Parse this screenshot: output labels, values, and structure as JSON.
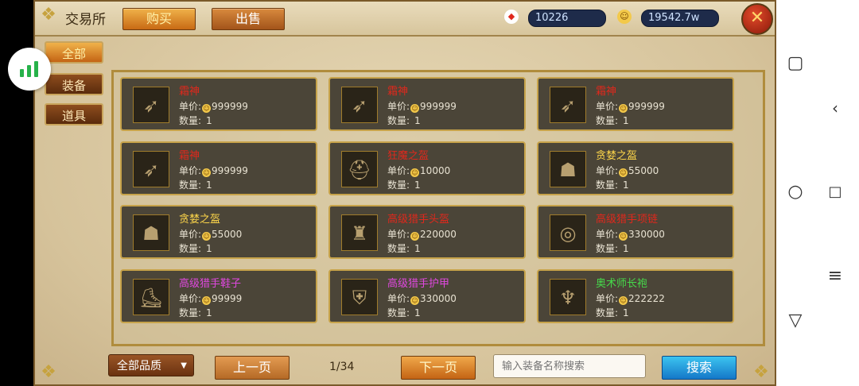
{
  "header": {
    "title": "交易所",
    "tab_buy": "购买",
    "tab_sell": "出售",
    "gems": "10226",
    "gold": "19542.7w"
  },
  "categories": [
    "全部",
    "装备",
    "道具"
  ],
  "items": [
    {
      "name": "霜神",
      "name_color": "red",
      "price_label": "单价:",
      "price": "999999",
      "qty_label": "数量:",
      "qty": "1",
      "icon": "crossbow-icon"
    },
    {
      "name": "霜神",
      "name_color": "red",
      "price_label": "单价:",
      "price": "999999",
      "qty_label": "数量:",
      "qty": "1",
      "icon": "crossbow-icon"
    },
    {
      "name": "霜神",
      "name_color": "red",
      "price_label": "单价:",
      "price": "999999",
      "qty_label": "数量:",
      "qty": "1",
      "icon": "crossbow-icon"
    },
    {
      "name": "霜神",
      "name_color": "red",
      "price_label": "单价:",
      "price": "999999",
      "qty_label": "数量:",
      "qty": "1",
      "icon": "crossbow-icon"
    },
    {
      "name": "狂魔之盔",
      "name_color": "red",
      "price_label": "单价:",
      "price": "10000",
      "qty_label": "数量:",
      "qty": "1",
      "icon": "helmet-icon"
    },
    {
      "name": "贪婪之盔",
      "name_color": "gold",
      "price_label": "单价:",
      "price": "55000",
      "qty_label": "数量:",
      "qty": "1",
      "icon": "hood-icon"
    },
    {
      "name": "贪婪之盔",
      "name_color": "gold",
      "price_label": "单价:",
      "price": "55000",
      "qty_label": "数量:",
      "qty": "1",
      "icon": "hood-icon"
    },
    {
      "name": "高级猎手头盔",
      "name_color": "red",
      "price_label": "单价:",
      "price": "220000",
      "qty_label": "数量:",
      "qty": "1",
      "icon": "horned-helmet-icon"
    },
    {
      "name": "高级猎手项链",
      "name_color": "red",
      "price_label": "单价:",
      "price": "330000",
      "qty_label": "数量:",
      "qty": "1",
      "icon": "ring-icon"
    },
    {
      "name": "高级猎手鞋子",
      "name_color": "pink",
      "price_label": "单价:",
      "price": "99999",
      "qty_label": "数量:",
      "qty": "1",
      "icon": "boots-icon"
    },
    {
      "name": "高级猎手护甲",
      "name_color": "pink",
      "price_label": "单价:",
      "price": "330000",
      "qty_label": "数量:",
      "qty": "1",
      "icon": "armor-icon"
    },
    {
      "name": "奥术师长袍",
      "name_color": "green",
      "price_label": "单价:",
      "price": "222222",
      "qty_label": "数量:",
      "qty": "1",
      "icon": "robe-icon"
    }
  ],
  "footer": {
    "quality": "全部品质",
    "prev": "上一页",
    "page": "1/34",
    "next": "下一页",
    "search_placeholder": "输入装备名称搜索",
    "search_btn": "搜索"
  },
  "colors": {
    "red": "#e0281c",
    "gold": "#ffd74a",
    "pink": "#e048e0",
    "green": "#46d94a"
  }
}
